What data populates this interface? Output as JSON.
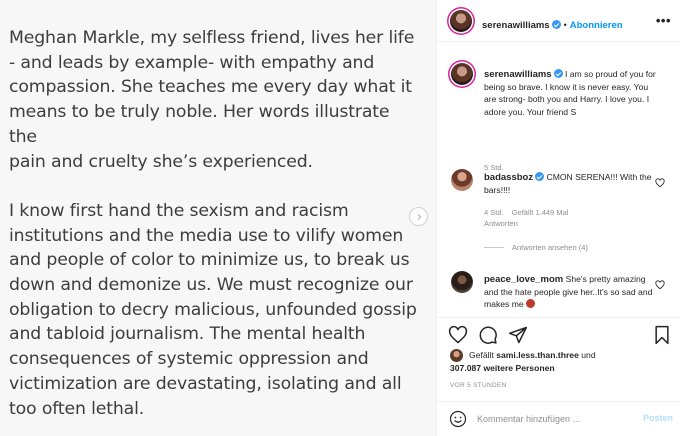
{
  "post": {
    "paragraphs": [
      "Meghan Markle, my selfless friend, lives her life\n- and leads by example- with empathy and\ncompassion. She teaches me every day what it\nmeans to be truly noble. Her words illustrate the\npain and cruelty she’s experienced.",
      "I know first hand the sexism and racism\ninstitutions and the media use to vilify women\nand people of color to minimize us, to break us\ndown and demonize us. We must recognize our\nobligation to decry malicious, unfounded gossip\nand tabloid journalism. The mental health\nconsequences of systemic oppression and\nvictimization are devastating, isolating and all\ntoo often lethal."
    ]
  },
  "header": {
    "username": "serenawilliams",
    "separator": "•",
    "follow_label": "Abonnieren",
    "more_label": "•••"
  },
  "caption": {
    "username": "serenawilliams",
    "text": " I am so proud of you for being so brave. I know it is never easy. You are strong- both you and Harry. I love you. I adore you. Your friend S",
    "time": "5 Std."
  },
  "comments": [
    {
      "username": "badassboz",
      "text": " CMON SERENA!!! With the bars!!!!",
      "time": "4 Std.",
      "likes": "Gefällt 1.449 Mal",
      "reply": "Antworten",
      "view_replies": "Antworten ansehen (4)"
    },
    {
      "username": "peace_love_mom",
      "text": " She's pretty amazing and the hate people give her..It's so sad and makes me"
    }
  ],
  "likes": {
    "prefix": "Gefällt ",
    "user": "sami.less.than.three",
    "middle": " und",
    "count": "307.087 weitere Personen"
  },
  "timestamp": "VOR 5 STUNDEN",
  "add_comment": {
    "placeholder": "Kommentar hinzufügen ...",
    "post_label": "Posten"
  },
  "colors": {
    "accent": "#0095f6",
    "verified": "#3897f0",
    "muted": "#8e8e8e"
  }
}
